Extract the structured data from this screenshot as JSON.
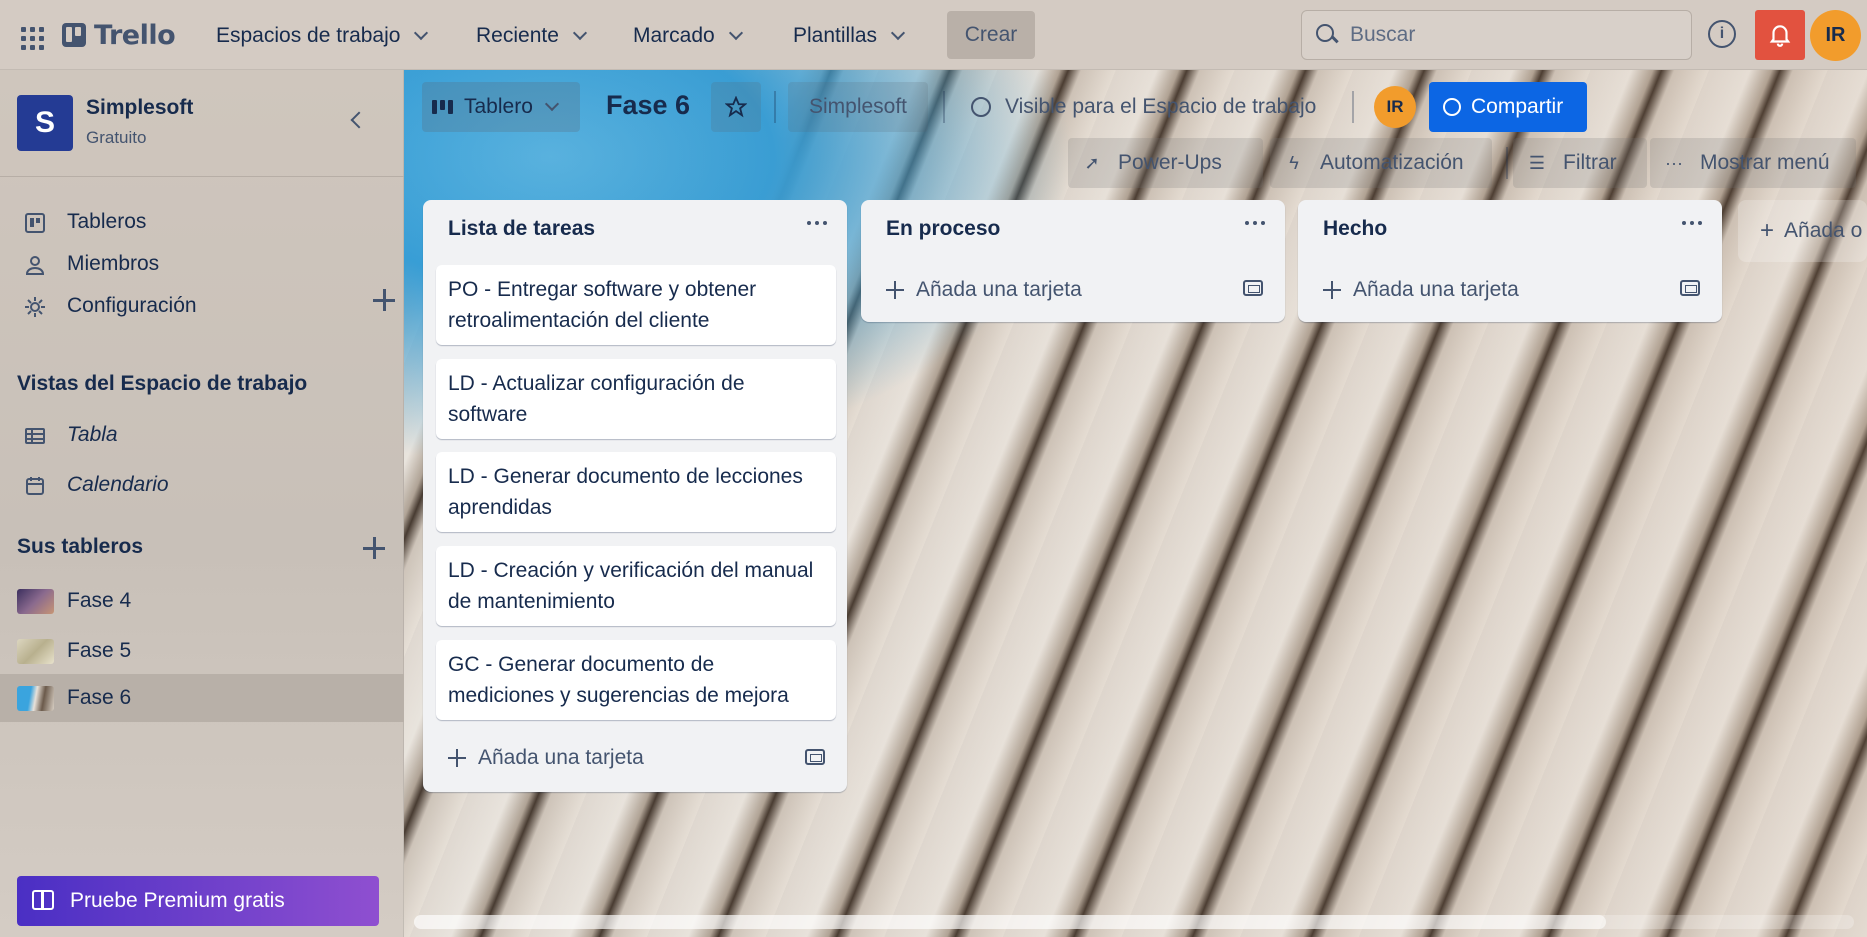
{
  "header": {
    "logo_text": "Trello",
    "nav": [
      "Espacios de trabajo",
      "Reciente",
      "Marcado",
      "Plantillas"
    ],
    "create_label": "Crear",
    "search_placeholder": "Buscar",
    "user_initials": "IR"
  },
  "sidebar": {
    "workspace_initial": "S",
    "workspace_name": "Simplesoft",
    "workspace_plan": "Gratuito",
    "items": [
      {
        "label": "Tableros",
        "icon": "board-icon"
      },
      {
        "label": "Miembros",
        "icon": "person-icon"
      },
      {
        "label": "Configuración",
        "icon": "gear-icon"
      }
    ],
    "views_heading": "Vistas del Espacio de trabajo",
    "views": [
      {
        "label": "Tabla",
        "icon": "table-icon"
      },
      {
        "label": "Calendario",
        "icon": "calendar-icon"
      }
    ],
    "boards_heading": "Sus tableros",
    "boards": [
      {
        "label": "Fase 4",
        "thumb_color": "#5a4a6e"
      },
      {
        "label": "Fase 5",
        "thumb_color": "#c9c2a8"
      },
      {
        "label": "Fase 6",
        "thumb_color": "#3aa4de"
      }
    ],
    "premium_label": "Pruebe Premium gratis"
  },
  "board": {
    "view_label": "Tablero",
    "title": "Fase 6",
    "workspace_label": "Simplesoft",
    "visibility_label": "Visible para el Espacio de trabajo",
    "member_initials": "IR",
    "share_label": "Compartir",
    "powerups_label": "Power-Ups",
    "automation_label": "Automatización",
    "filter_label": "Filtrar",
    "menu_label": "Mostrar menú",
    "add_list_label": "Añada o",
    "add_card_label": "Añada una tarjeta",
    "lists": [
      {
        "title": "Lista de tareas",
        "cards": [
          "PO - Entregar software y obtener retroalimentación del cliente",
          "LD - Actualizar configuración de software",
          "LD - Generar documento de lecciones aprendidas",
          "LD - Creación y verificación del manual de mantenimiento",
          "GC - Generar documento de mediciones y sugerencias de mejora"
        ]
      },
      {
        "title": "En proceso",
        "cards": []
      },
      {
        "title": "Hecho",
        "cards": []
      }
    ]
  },
  "colors": {
    "accent": "#0c66e4",
    "notification": "#e2523f",
    "avatar": "#f29c2c",
    "workspace": "#243b94"
  }
}
